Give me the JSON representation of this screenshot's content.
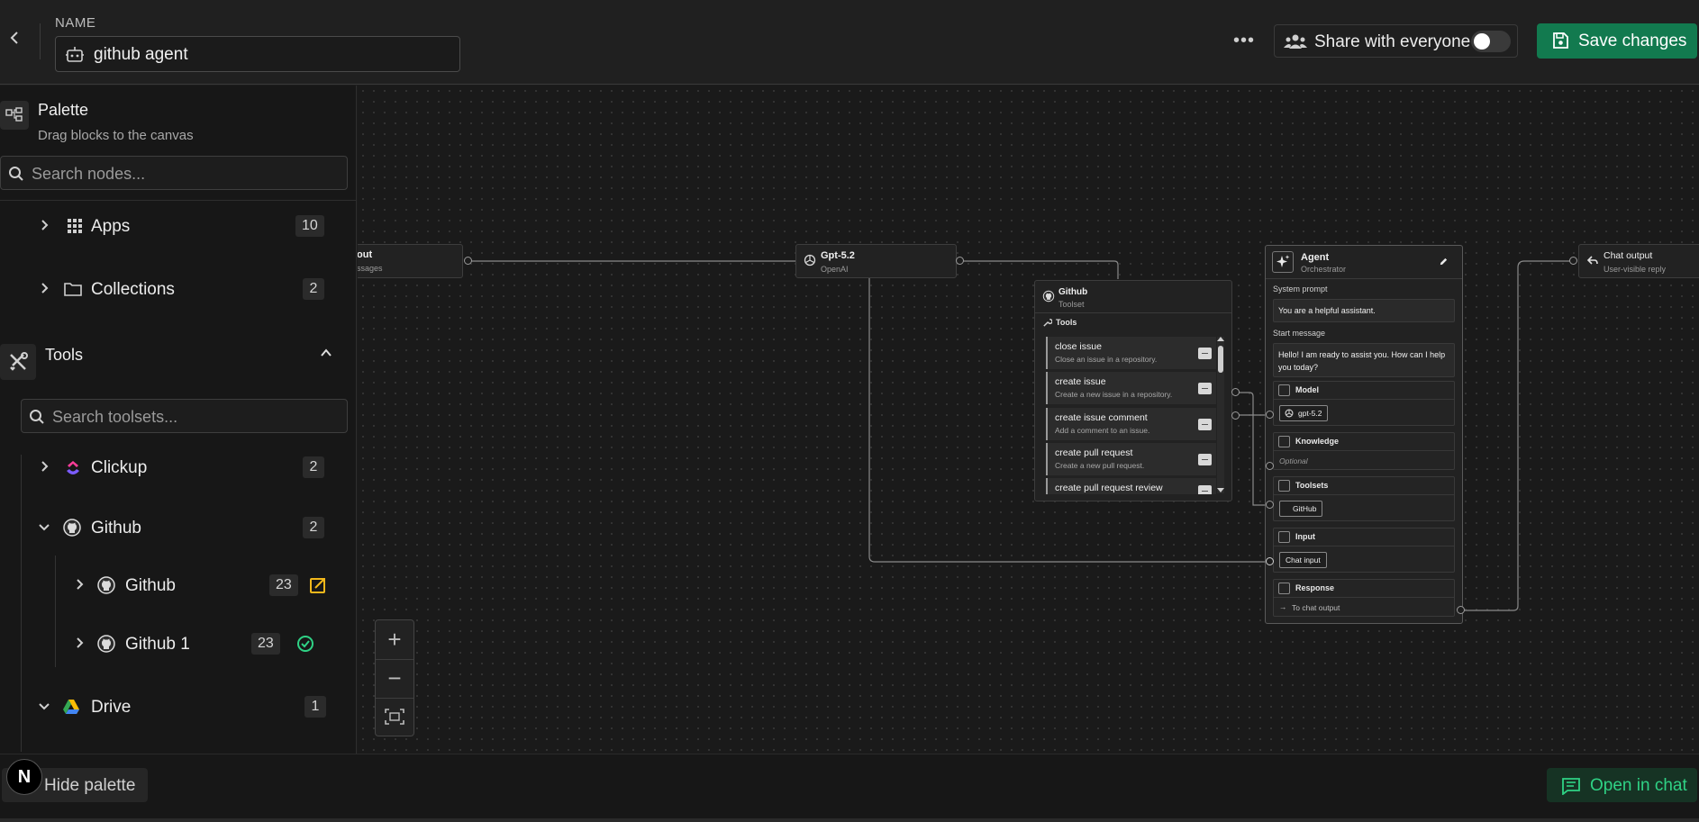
{
  "header": {
    "name_label": "NAME",
    "agent_name": "github agent",
    "more_label": "•••",
    "share_label": "Share with everyone",
    "share_enabled": false,
    "save_label": "Save changes"
  },
  "palette": {
    "title": "Palette",
    "subtitle": "Drag blocks to the canvas",
    "search_placeholder": "Search nodes...",
    "groups": [
      {
        "label": "Apps",
        "count": "10"
      },
      {
        "label": "Collections",
        "count": "2"
      }
    ],
    "tools": {
      "label": "Tools",
      "search_placeholder": "Search toolsets...",
      "items": [
        {
          "label": "Clickup",
          "count": "2"
        },
        {
          "label": "Github",
          "count": "2"
        },
        {
          "label": "Github",
          "count": "23"
        },
        {
          "label": "Github 1",
          "count": "23"
        },
        {
          "label": "Drive",
          "count": "1"
        }
      ]
    }
  },
  "bottom": {
    "hide_palette_label": "Hide palette",
    "logo_letter": "N",
    "open_chat_label": "Open in chat"
  },
  "canvas": {
    "input_node": {
      "title": "out",
      "subtitle": "ssages"
    },
    "model_node": {
      "title": "Gpt-5.2",
      "subtitle": "OpenAI"
    },
    "toolset_node": {
      "title": "Github",
      "subtitle": "Toolset",
      "tools_label": "Tools",
      "tools": [
        {
          "name": "close issue",
          "desc": "Close an issue in a repository."
        },
        {
          "name": "create issue",
          "desc": "Create a new issue in a repository."
        },
        {
          "name": "create issue comment",
          "desc": "Add a comment to an issue."
        },
        {
          "name": "create pull request",
          "desc": "Create a new pull request."
        },
        {
          "name": "create pull request review",
          "desc": ""
        }
      ]
    },
    "agent_node": {
      "title": "Agent",
      "subtitle": "Orchestrator",
      "system_prompt_label": "System prompt",
      "system_prompt": "You are a helpful assistant.",
      "start_message_label": "Start message",
      "start_message": "Hello! I am ready to assist you. How can I help you today?",
      "model_label": "Model",
      "model_value": "gpt-5.2",
      "knowledge_label": "Knowledge",
      "knowledge_value": "Optional",
      "toolsets_label": "Toolsets",
      "toolsets_value": "GitHub",
      "input_label": "Input",
      "input_value": "Chat input",
      "response_label": "Response",
      "response_value": "To chat output"
    },
    "output_node": {
      "title": "Chat output",
      "subtitle": "User-visible reply"
    }
  },
  "zoom": {
    "in": "+",
    "out": "−"
  }
}
